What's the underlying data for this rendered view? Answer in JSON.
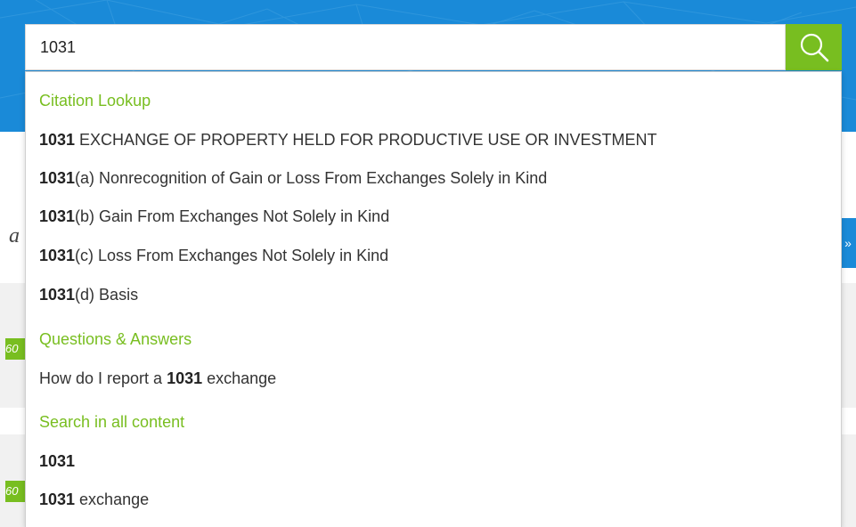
{
  "search": {
    "value": "1031"
  },
  "colors": {
    "banner_blue": "#1a8ad8",
    "accent_green": "#78be20",
    "section_header": "#78be20"
  },
  "icons": {
    "search_button": "search-icon"
  },
  "dropdown": {
    "sections": [
      {
        "header": "Citation Lookup",
        "items": [
          {
            "bold": "1031",
            "text": " EXCHANGE OF PROPERTY HELD FOR PRODUCTIVE USE OR INVESTMENT"
          },
          {
            "bold": "1031",
            "text": "(a) Nonrecognition of Gain or Loss From Exchanges Solely in Kind"
          },
          {
            "bold": "1031",
            "text": "(b) Gain From Exchanges Not Solely in Kind"
          },
          {
            "bold": "1031",
            "text": "(c) Loss From Exchanges Not Solely in Kind"
          },
          {
            "bold": "1031",
            "text": "(d) Basis"
          }
        ]
      },
      {
        "header": "Questions & Answers",
        "items": [
          {
            "prefix": "How do I report a ",
            "bold": "1031",
            "text": " exchange"
          }
        ]
      },
      {
        "header": "Search in all content",
        "items": [
          {
            "bold": "1031",
            "text": ""
          },
          {
            "bold": "1031",
            "text": " exchange"
          }
        ]
      }
    ]
  },
  "background": {
    "glyph": "a",
    "right_arrow": "»",
    "badge_1": "60",
    "badge_2": "60"
  }
}
